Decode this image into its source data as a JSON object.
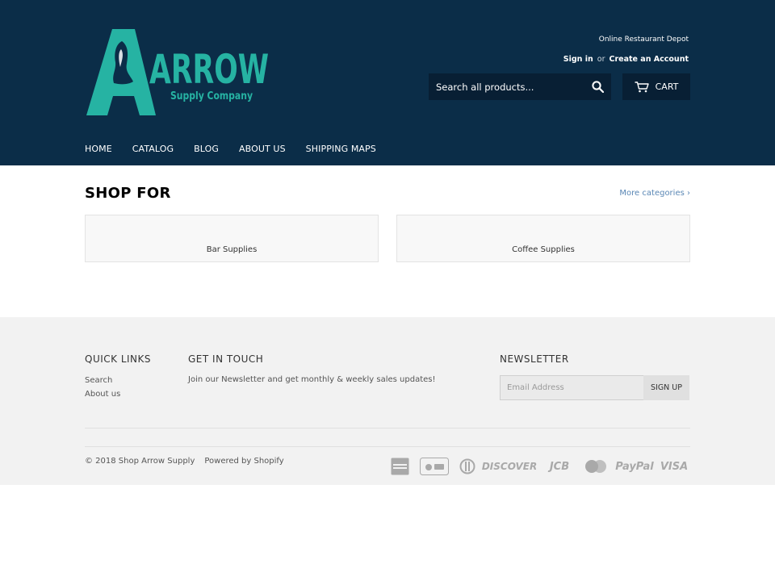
{
  "header": {
    "tagline": "Online Restaurant Depot",
    "sign_in": "Sign in",
    "or": "or",
    "create_account": "Create an Account",
    "search_placeholder": "Search all products...",
    "cart_label": "CART",
    "colors": {
      "background": "#0b2d48",
      "logo": "#26b3a3"
    }
  },
  "logo": {
    "word": "ARROW",
    "sub": "Supply Company"
  },
  "nav": [
    "HOME",
    "CATALOG",
    "BLOG",
    "ABOUT US",
    "SHIPPING MAPS"
  ],
  "main": {
    "title": "SHOP FOR",
    "more_categories": "More categories ›",
    "categories": [
      "Bar Supplies",
      "Coffee Supplies"
    ]
  },
  "footer": {
    "quick_links_heading": "QUICK LINKS",
    "quick_links": [
      "Search",
      "About us"
    ],
    "get_in_touch_heading": "GET IN TOUCH",
    "get_in_touch_text": "Join our Newsletter and get monthly & weekly sales updates!",
    "newsletter_heading": "NEWSLETTER",
    "email_placeholder": "Email Address",
    "signup_label": "SIGN UP",
    "copyright": "© 2018 Shop Arrow Supply",
    "powered_by": "Powered by Shopify",
    "payment_icons": [
      "american-express-icon",
      "apple-pay-icon",
      "diners-club-icon",
      "discover-icon",
      "jcb-icon",
      "master-icon",
      "paypal-icon",
      "visa-icon"
    ],
    "payment_labels": {
      "discover": "DISCOVER",
      "jcb": "JCB",
      "paypal": "PayPal",
      "visa": "VISA"
    }
  }
}
